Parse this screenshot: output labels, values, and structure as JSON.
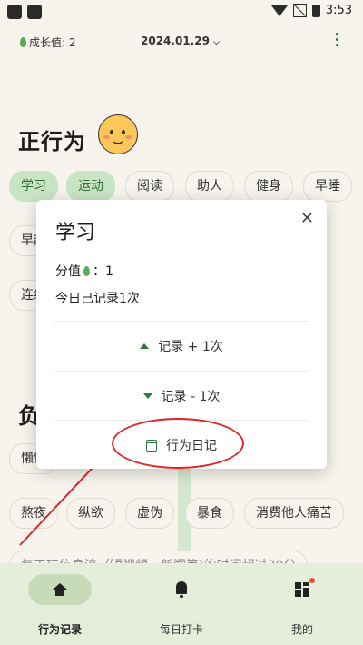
{
  "status_bar": {
    "time": "3:53"
  },
  "header": {
    "growth_label": "成长值: 2",
    "date": "2024.01.29"
  },
  "positive_section": {
    "title": "正行为",
    "emoji_icon": "smiley-face"
  },
  "positive_chips": [
    {
      "label": "学习",
      "selected": true
    },
    {
      "label": "运动",
      "selected": true
    },
    {
      "label": "阅读",
      "selected": false
    },
    {
      "label": "助人",
      "selected": false
    },
    {
      "label": "健身",
      "selected": false
    },
    {
      "label": "早睡",
      "selected": false
    },
    {
      "label": "早起",
      "selected": false
    },
    {
      "label": "连续",
      "selected": false
    }
  ],
  "negative_section": {
    "title_partial": "负"
  },
  "negative_chips": [
    {
      "label": "懒惰"
    },
    {
      "label": "熬夜"
    },
    {
      "label": "纵欲"
    },
    {
      "label": "虚伪"
    },
    {
      "label": "暴食"
    },
    {
      "label": "消费他人痛苦"
    }
  ],
  "bottom_line_text": "每天玩信息流（短视频，新闻等)的时间超过30分",
  "popup": {
    "title": "学习",
    "score_label": "分值",
    "score_value": "：1",
    "today_text": "今日已记录1次",
    "add_action": "记录 + 1次",
    "sub_action": "记录 - 1次",
    "diary_action": "行为日记",
    "highlight_color": "#e0262a"
  },
  "nav": [
    {
      "label": "行为记录",
      "icon": "home-icon",
      "active": true
    },
    {
      "label": "每日打卡",
      "icon": "bell-icon",
      "active": false
    },
    {
      "label": "我的",
      "icon": "grid-icon",
      "active": false
    }
  ],
  "colors": {
    "accent": "#2f7a3a",
    "chip_selected": "#c9e4c4",
    "background": "#f6f4ec"
  }
}
